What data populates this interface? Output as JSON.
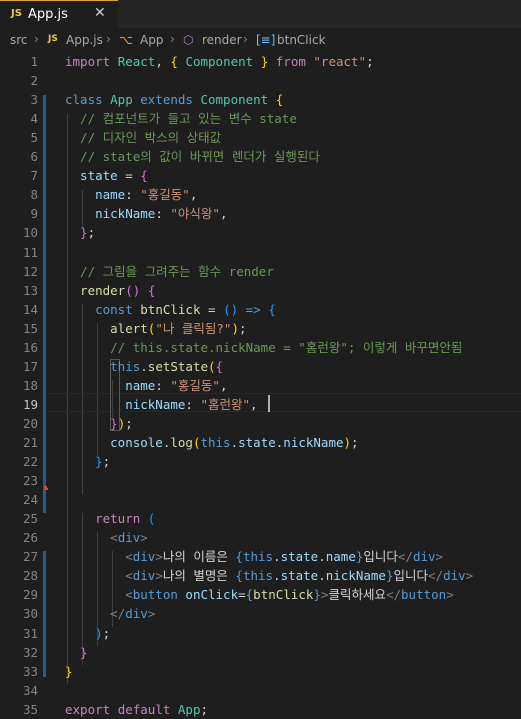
{
  "tab": {
    "badge": "JS",
    "title": "App.js",
    "close": "✕"
  },
  "breadcrumb": {
    "src": "src",
    "js_badge": "JS",
    "file": "App.js",
    "class_icon": "class-icon",
    "class_name": "App",
    "method_icon": "method-icon",
    "method_name": "render",
    "var_icon": "variable-icon",
    "var_name": "btnClick"
  },
  "editor": {
    "line_numbers": [
      "1",
      "2",
      "3",
      "4",
      "5",
      "6",
      "7",
      "8",
      "9",
      "10",
      "11",
      "12",
      "13",
      "14",
      "15",
      "16",
      "17",
      "18",
      "19",
      "20",
      "21",
      "22",
      "23",
      "24",
      "25",
      "26",
      "27",
      "28",
      "29",
      "30",
      "31",
      "32",
      "33",
      "34",
      "35"
    ],
    "lines": {
      "l1": [
        [
          "k1",
          "import "
        ],
        [
          "ty",
          "React"
        ],
        [
          "pn",
          ", "
        ],
        [
          "br1",
          "{ "
        ],
        [
          "ty",
          "Component"
        ],
        [
          "br1",
          " }"
        ],
        [
          "k1",
          " from "
        ],
        [
          "st",
          "\"react\""
        ],
        [
          "pn",
          ";"
        ]
      ],
      "l3": [
        [
          "k2",
          "class "
        ],
        [
          "ty",
          "App"
        ],
        [
          "k2",
          " extends "
        ],
        [
          "ty",
          "Component"
        ],
        [
          "pn",
          " "
        ],
        [
          "br1",
          "{"
        ]
      ],
      "l4": [
        [
          "cm",
          "  // 컴포넌트가 들고 있는 변수 state"
        ]
      ],
      "l5": [
        [
          "cm",
          "  // 디자인 박스의 상태값"
        ]
      ],
      "l6": [
        [
          "cm",
          "  // state의 값이 바뀌면 렌더가 실행된다"
        ]
      ],
      "l7": [
        [
          "vr",
          "  state"
        ],
        [
          "pn",
          " = "
        ],
        [
          "br2",
          "{"
        ]
      ],
      "l8": [
        [
          "vr",
          "    name"
        ],
        [
          "pn",
          ": "
        ],
        [
          "st",
          "\"홍길동\""
        ],
        [
          "pn",
          ","
        ]
      ],
      "l9": [
        [
          "vr",
          "    nickName"
        ],
        [
          "pn",
          ": "
        ],
        [
          "st",
          "\"야식왕\""
        ],
        [
          "pn",
          ","
        ]
      ],
      "l10": [
        [
          "br2",
          "  }"
        ],
        [
          "pn",
          ";"
        ]
      ],
      "l12": [
        [
          "cm",
          "  // 그림을 그려주는 함수 render"
        ]
      ],
      "l13": [
        [
          "fn",
          "  render"
        ],
        [
          "br2",
          "()"
        ],
        [
          "pn",
          " "
        ],
        [
          "br2",
          "{"
        ]
      ],
      "l14": [
        [
          "k2",
          "    const "
        ],
        [
          "fn",
          "btnClick"
        ],
        [
          "pn",
          " = "
        ],
        [
          "br3",
          "()"
        ],
        [
          "k2",
          " =>"
        ],
        [
          "pn",
          " "
        ],
        [
          "br3",
          "{"
        ]
      ],
      "l15": [
        [
          "fn",
          "      alert"
        ],
        [
          "br1",
          "("
        ],
        [
          "st",
          "\"나 클릭됨?\""
        ],
        [
          "br1",
          ")"
        ],
        [
          "pn",
          ";"
        ]
      ],
      "l16": [
        [
          "cm",
          "      // this.state.nickName = \"홈런왕\"; 이렇게 바꾸면안됨"
        ]
      ],
      "l17": [
        [
          "k2",
          "      this"
        ],
        [
          "pn",
          "."
        ],
        [
          "fn",
          "setState"
        ],
        [
          "br1",
          "("
        ],
        [
          "br2",
          "{"
        ]
      ],
      "l18": [
        [
          "vr",
          "        name"
        ],
        [
          "pn",
          ": "
        ],
        [
          "st",
          "\"홍길동\""
        ],
        [
          "pn",
          ","
        ]
      ],
      "l19": [
        [
          "vr",
          "        nickName"
        ],
        [
          "pn",
          ": "
        ],
        [
          "st",
          "\"홈런왕\""
        ],
        [
          "pn",
          ","
        ]
      ],
      "l20": [
        [
          "br2",
          "      }"
        ],
        [
          "br1",
          ")"
        ],
        [
          "pn",
          ";"
        ]
      ],
      "l21": [
        [
          "vr",
          "      console"
        ],
        [
          "pn",
          "."
        ],
        [
          "fn",
          "log"
        ],
        [
          "br1",
          "("
        ],
        [
          "k2",
          "this"
        ],
        [
          "pn",
          "."
        ],
        [
          "vr",
          "state"
        ],
        [
          "pn",
          "."
        ],
        [
          "vr",
          "nickName"
        ],
        [
          "br1",
          ")"
        ],
        [
          "pn",
          ";"
        ]
      ],
      "l22": [
        [
          "br3",
          "    }"
        ],
        [
          "pn",
          ";"
        ]
      ],
      "l25": [
        [
          "k1",
          "    return "
        ],
        [
          "br3",
          "("
        ]
      ],
      "l26": [
        [
          "tg",
          "      <"
        ],
        [
          "tn",
          "div"
        ],
        [
          "tg",
          ">"
        ]
      ],
      "l27": [
        [
          "tg",
          "        <"
        ],
        [
          "tn",
          "div"
        ],
        [
          "tg",
          ">"
        ],
        [
          "tx",
          "나의 이름은 "
        ],
        [
          "k2",
          "{"
        ],
        [
          "k2",
          "this"
        ],
        [
          "pn",
          "."
        ],
        [
          "vr",
          "state"
        ],
        [
          "pn",
          "."
        ],
        [
          "vr",
          "name"
        ],
        [
          "k2",
          "}"
        ],
        [
          "tx",
          "입니다"
        ],
        [
          "tg",
          "</"
        ],
        [
          "tn",
          "div"
        ],
        [
          "tg",
          ">"
        ]
      ],
      "l28": [
        [
          "tg",
          "        <"
        ],
        [
          "tn",
          "div"
        ],
        [
          "tg",
          ">"
        ],
        [
          "tx",
          "나의 별명은 "
        ],
        [
          "k2",
          "{"
        ],
        [
          "k2",
          "this"
        ],
        [
          "pn",
          "."
        ],
        [
          "vr",
          "state"
        ],
        [
          "pn",
          "."
        ],
        [
          "vr",
          "nickName"
        ],
        [
          "k2",
          "}"
        ],
        [
          "tx",
          "입니다"
        ],
        [
          "tg",
          "</"
        ],
        [
          "tn",
          "div"
        ],
        [
          "tg",
          ">"
        ]
      ],
      "l29": [
        [
          "tg",
          "        <"
        ],
        [
          "tn",
          "button"
        ],
        [
          "vr",
          " onClick"
        ],
        [
          "pn",
          "="
        ],
        [
          "k2",
          "{"
        ],
        [
          "fn",
          "btnClick"
        ],
        [
          "k2",
          "}"
        ],
        [
          "tg",
          ">"
        ],
        [
          "tx",
          "클릭하세요"
        ],
        [
          "tg",
          "</"
        ],
        [
          "tn",
          "button"
        ],
        [
          "tg",
          ">"
        ]
      ],
      "l30": [
        [
          "tg",
          "      </"
        ],
        [
          "tn",
          "div"
        ],
        [
          "tg",
          ">"
        ]
      ],
      "l31": [
        [
          "br3",
          "    )"
        ],
        [
          "pn",
          ";"
        ]
      ],
      "l32": [
        [
          "br2",
          "  }"
        ]
      ],
      "l33": [
        [
          "br1",
          "}"
        ]
      ],
      "l35": [
        [
          "k1",
          "export "
        ],
        [
          "k1",
          "default "
        ],
        [
          "ty",
          "App"
        ],
        [
          "pn",
          ";"
        ]
      ]
    }
  }
}
